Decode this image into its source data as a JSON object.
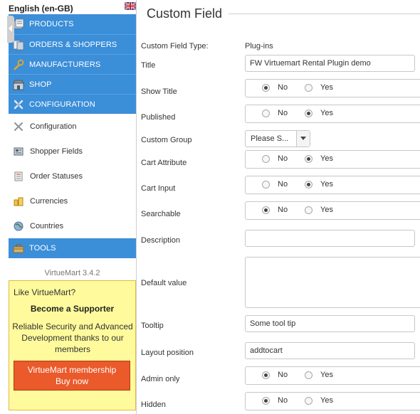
{
  "language": {
    "label": "English (en-GB)",
    "flag_icon": "uk-flag-icon"
  },
  "sidebar": {
    "menu_top": [
      {
        "label": "PRODUCTS",
        "icon": "products-icon"
      },
      {
        "label": "ORDERS & SHOPPERS",
        "icon": "orders-icon"
      },
      {
        "label": "MANUFACTURERS",
        "icon": "wrench-icon"
      },
      {
        "label": "SHOP",
        "icon": "shop-icon"
      },
      {
        "label": "CONFIGURATION",
        "icon": "configuration-icon"
      }
    ],
    "sub_items": [
      {
        "label": "Configuration",
        "icon": "tools-icon"
      },
      {
        "label": "Shopper Fields",
        "icon": "shopper-fields-icon"
      },
      {
        "label": "Order Statuses",
        "icon": "order-statuses-icon"
      },
      {
        "label": "Currencies",
        "icon": "currencies-icon"
      },
      {
        "label": "Countries",
        "icon": "globe-icon"
      }
    ],
    "menu_tools": {
      "label": "TOOLS",
      "icon": "tools-box-icon"
    },
    "version": "VirtueMart 3.4.2",
    "promo": {
      "question": "Like VirtueMart?",
      "title": "Become a Supporter",
      "body": "Reliable Security and Advanced Development thanks to our members",
      "button_line1": "VirtueMart membership",
      "button_line2": "Buy now"
    },
    "colors": {
      "menu_blue": "#3b8ed8",
      "promo_bg": "#fffb9c",
      "promo_button": "#ea5a2b"
    }
  },
  "main": {
    "title": "Custom Field",
    "fields": {
      "type": {
        "label": "Custom Field Type:",
        "value": "Plug-ins"
      },
      "title": {
        "label": "Title",
        "value": "FW Virtuemart Rental Plugin demo"
      },
      "show_title": {
        "label": "Show Title",
        "no": "No",
        "yes": "Yes",
        "selected": "No"
      },
      "published": {
        "label": "Published",
        "no": "No",
        "yes": "Yes",
        "selected": "Yes"
      },
      "custom_group": {
        "label": "Custom Group",
        "value": "Please S..."
      },
      "cart_attribute": {
        "label": "Cart Attribute",
        "no": "No",
        "yes": "Yes",
        "selected": "Yes"
      },
      "cart_input": {
        "label": "Cart Input",
        "no": "No",
        "yes": "Yes",
        "selected": "Yes"
      },
      "searchable": {
        "label": "Searchable",
        "no": "No",
        "yes": "Yes",
        "selected": "No"
      },
      "description": {
        "label": "Description",
        "value": ""
      },
      "default_value": {
        "label": "Default value",
        "value": ""
      },
      "tooltip": {
        "label": "Tooltip",
        "value": "Some tool tip"
      },
      "layout_position": {
        "label": "Layout position",
        "value": "addtocart"
      },
      "admin_only": {
        "label": "Admin only",
        "no": "No",
        "yes": "Yes",
        "selected": "No"
      },
      "hidden": {
        "label": "Hidden",
        "no": "No",
        "yes": "Yes",
        "selected": "No"
      }
    }
  }
}
